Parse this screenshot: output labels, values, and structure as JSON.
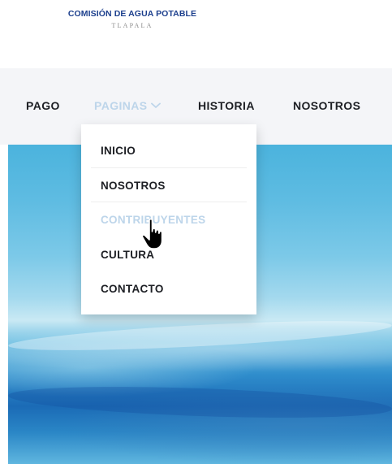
{
  "logo": {
    "title": "COMISIÓN DE AGUA POTABLE",
    "subtitle": "TLAPALA"
  },
  "nav": {
    "items": [
      {
        "label": "PAGO"
      },
      {
        "label": "PAGINAS",
        "state": "hover"
      },
      {
        "label": "HISTORIA"
      },
      {
        "label": "NOSOTROS"
      }
    ]
  },
  "dropdown": {
    "items": [
      {
        "label": "INICIO"
      },
      {
        "label": "NOSOTROS"
      },
      {
        "label": "CONTRIBUYENTES",
        "state": "hover"
      },
      {
        "label": "CULTURA"
      },
      {
        "label": "CONTACTO"
      }
    ]
  },
  "colors": {
    "brand": "#1c3f8d",
    "text": "#1d1f24",
    "hover": "#bdd5ea",
    "nav_bg": "#f4f5f8"
  },
  "icons": {
    "dropdown_arrow": "chevron-down-icon",
    "cursor": "hand-pointer-icon"
  }
}
